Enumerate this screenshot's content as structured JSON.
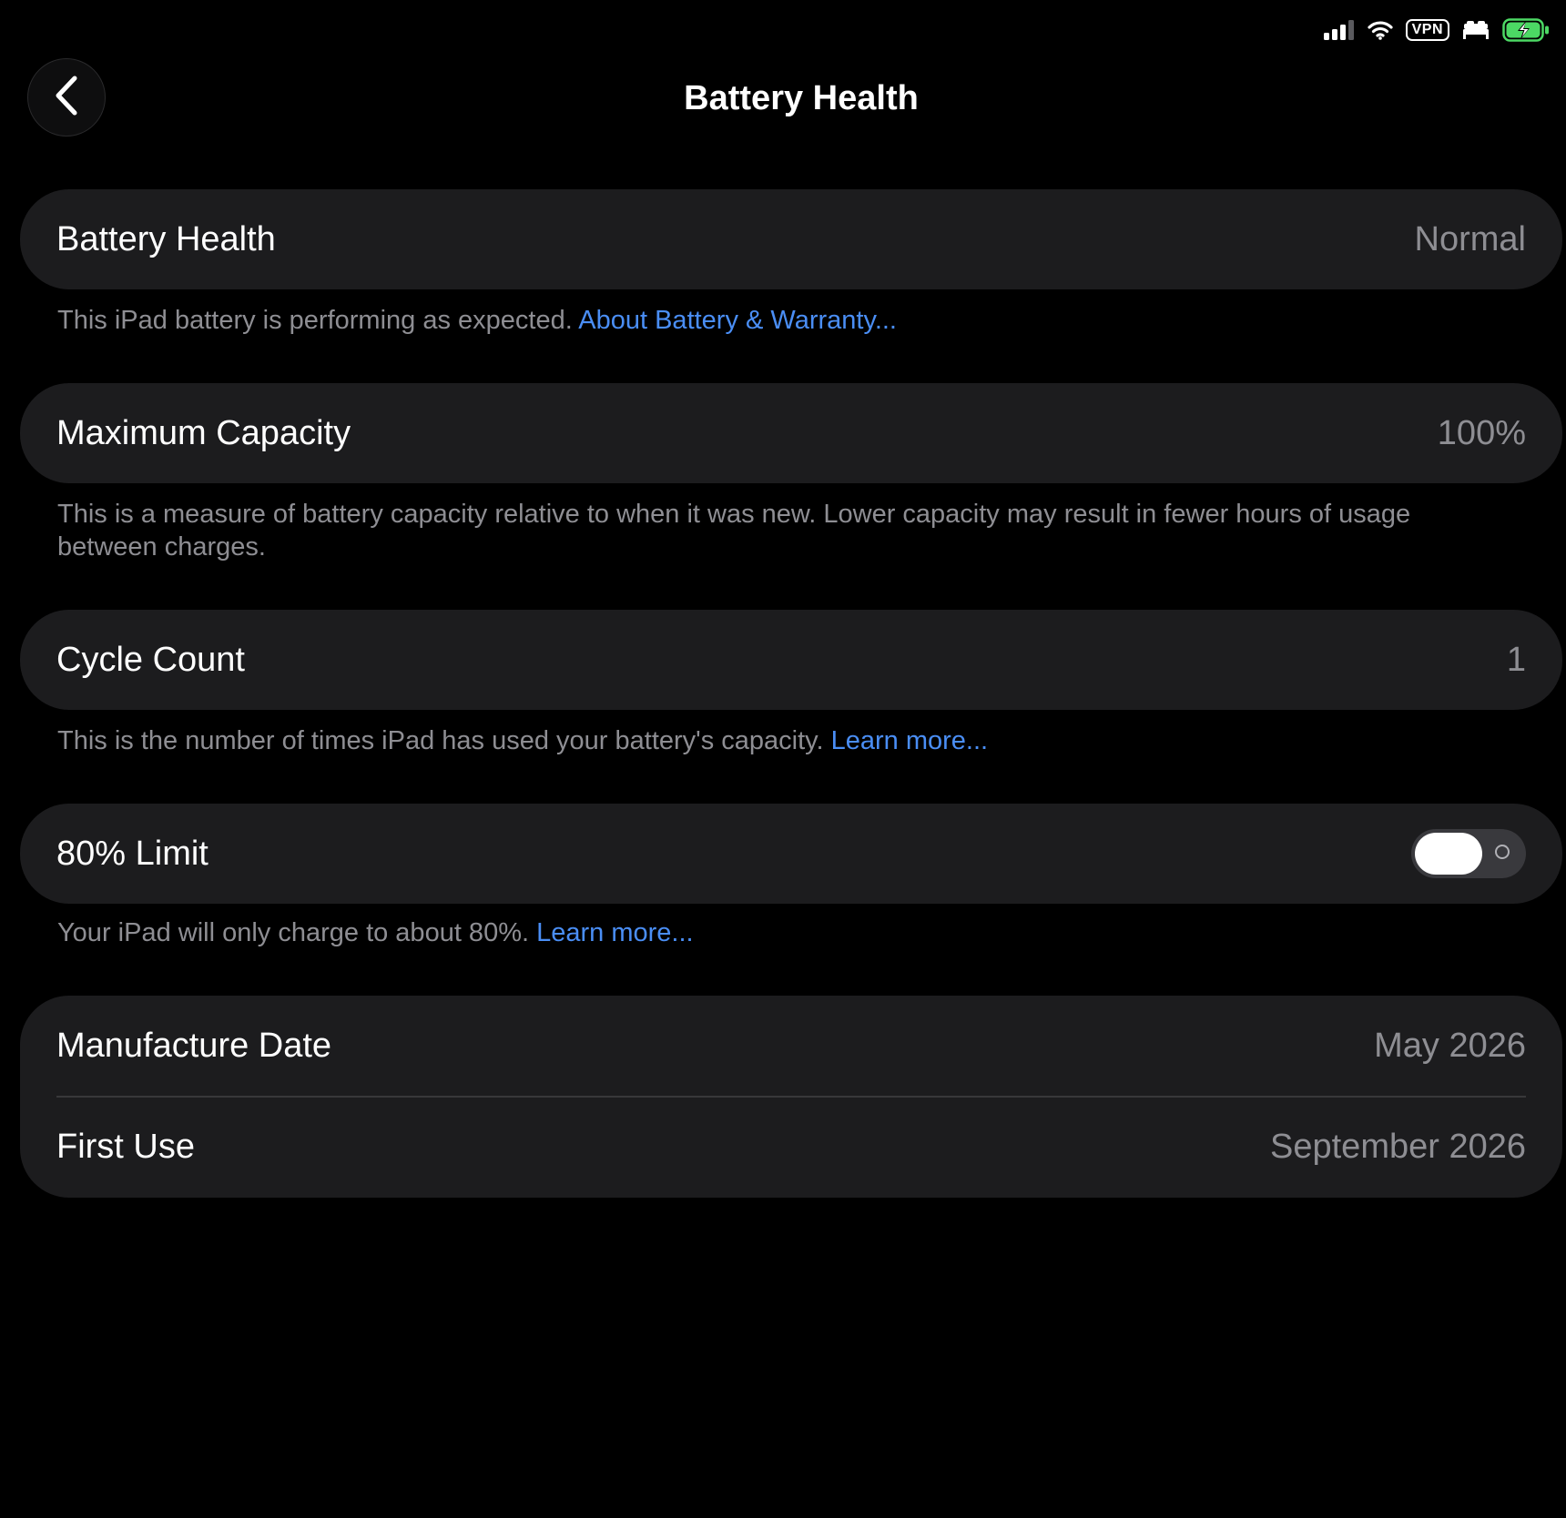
{
  "status_bar": {
    "vpn_label": "VPN",
    "battery_color": "#4cd964"
  },
  "header": {
    "title": "Battery Health"
  },
  "battery_health": {
    "label": "Battery Health",
    "value": "Normal",
    "footnote": "This iPad battery is performing as expected.",
    "footnote_link": "About Battery & Warranty..."
  },
  "maximum_capacity": {
    "label": "Maximum Capacity",
    "value": "100%",
    "footnote": "This is a measure of battery capacity relative to when it was new. Lower capacity may result in fewer hours of usage between charges."
  },
  "cycle_count": {
    "label": "Cycle Count",
    "value": "1",
    "footnote": "This is the number of times iPad has used your battery's capacity.",
    "footnote_link": "Learn more..."
  },
  "limit_80": {
    "label": "80% Limit",
    "enabled": false,
    "footnote": "Your iPad will only charge to about 80%.",
    "footnote_link": "Learn more..."
  },
  "dates": {
    "manufacture_label": "Manufacture Date",
    "manufacture_value": "May 2026",
    "first_use_label": "First Use",
    "first_use_value": "September 2026"
  },
  "colors": {
    "background": "#000000",
    "card": "#1c1c1e",
    "secondary_text": "#8e8e93",
    "link": "#4a8ef5"
  }
}
